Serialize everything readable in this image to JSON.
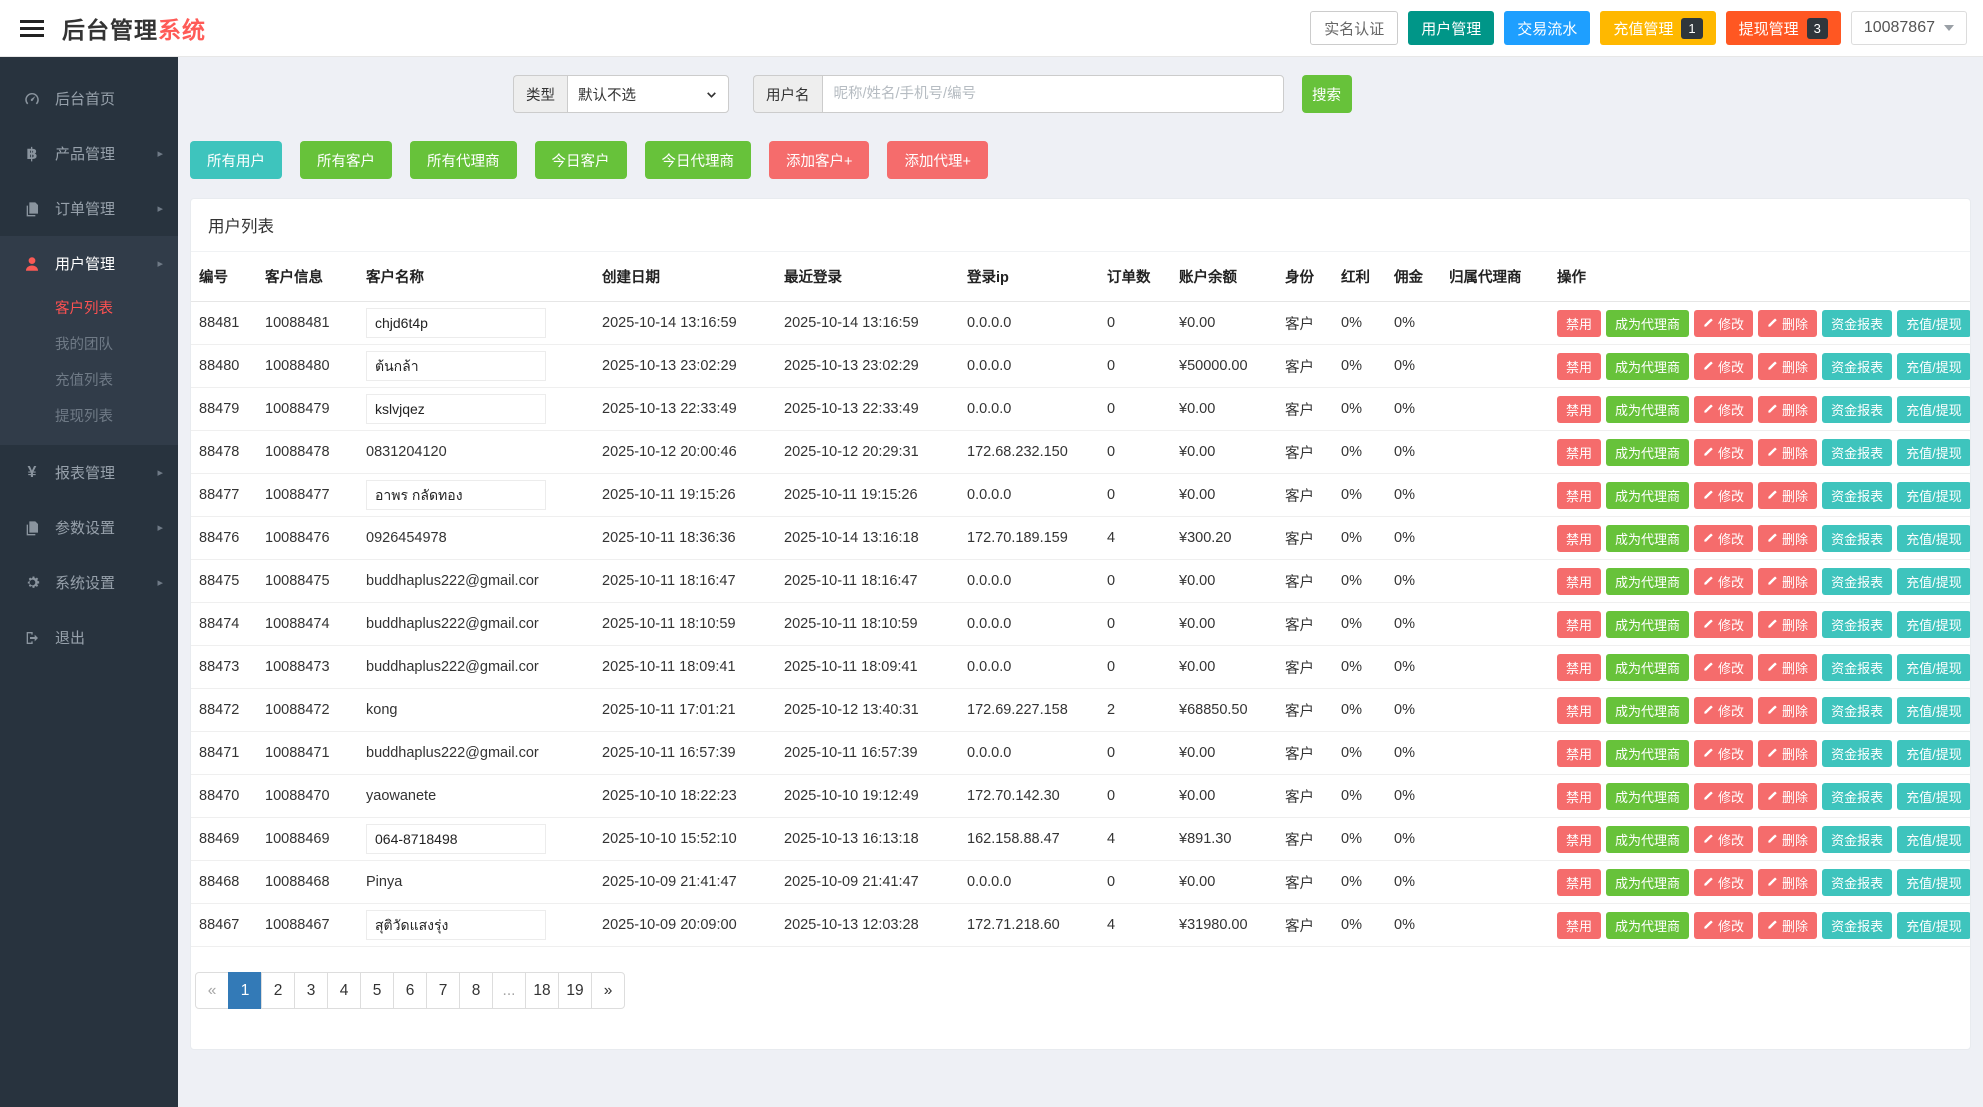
{
  "header": {
    "title_primary": "后台管理",
    "title_accent": "系统",
    "buttons": [
      {
        "key": "real-name-auth-button",
        "label": "实名认证",
        "style": "plain",
        "badge": ""
      },
      {
        "key": "user-manage-button",
        "label": "用户管理",
        "style": "teal",
        "badge": ""
      },
      {
        "key": "transaction-flow-button",
        "label": "交易流水",
        "style": "blue",
        "badge": ""
      },
      {
        "key": "recharge-manage-button",
        "label": "充值管理",
        "style": "amber",
        "badge": "1"
      },
      {
        "key": "withdraw-manage-button",
        "label": "提现管理",
        "style": "orange",
        "badge": "3"
      }
    ],
    "user_id": "10087867"
  },
  "sidebar": {
    "items": [
      {
        "key": "home",
        "label": "后台首页",
        "icon": "dashboard-icon",
        "arrow": false,
        "active": false
      },
      {
        "key": "product",
        "label": "产品管理",
        "icon": "baht-icon",
        "arrow": true,
        "active": false
      },
      {
        "key": "orders",
        "label": "订单管理",
        "icon": "files-icon",
        "arrow": true,
        "active": false
      },
      {
        "key": "users",
        "label": "用户管理",
        "icon": "user-icon",
        "arrow": true,
        "active": true,
        "children": [
          {
            "key": "customer-list",
            "label": "客户列表",
            "active": true
          },
          {
            "key": "my-team",
            "label": "我的团队",
            "active": false
          },
          {
            "key": "recharge-list",
            "label": "充值列表",
            "active": false
          },
          {
            "key": "withdraw-list",
            "label": "提现列表",
            "active": false
          }
        ]
      },
      {
        "key": "reports",
        "label": "报表管理",
        "icon": "yen-icon",
        "arrow": true,
        "active": false
      },
      {
        "key": "params",
        "label": "参数设置",
        "icon": "files-icon",
        "arrow": true,
        "active": false
      },
      {
        "key": "system",
        "label": "系统设置",
        "icon": "gear-icon",
        "arrow": true,
        "active": false
      },
      {
        "key": "logout",
        "label": "退出",
        "icon": "logout-icon",
        "arrow": false,
        "active": false
      }
    ]
  },
  "search": {
    "type_label": "类型",
    "type_value": "默认不选",
    "username_label": "用户名",
    "username_placeholder": "昵称/姓名/手机号/编号",
    "search_button": "搜索"
  },
  "filters": [
    {
      "key": "all-users-button",
      "label": "所有用户",
      "color": "cyan"
    },
    {
      "key": "all-customers-button",
      "label": "所有客户",
      "color": "green"
    },
    {
      "key": "all-agents-button",
      "label": "所有代理商",
      "color": "green"
    },
    {
      "key": "today-customers-button",
      "label": "今日客户",
      "color": "green"
    },
    {
      "key": "today-agents-button",
      "label": "今日代理商",
      "color": "green"
    },
    {
      "key": "add-customer-button",
      "label": "添加客户+",
      "color": "red"
    },
    {
      "key": "add-agent-button",
      "label": "添加代理+",
      "color": "red"
    }
  ],
  "table": {
    "panel_title": "用户列表",
    "columns": [
      "编号",
      "客户信息",
      "客户名称",
      "创建日期",
      "最近登录",
      "登录ip",
      "订单数",
      "账户余额",
      "身份",
      "红利",
      "佣金",
      "归属代理商",
      "操作"
    ],
    "action_buttons": [
      {
        "key": "disable-button",
        "label": "禁用",
        "color": "red",
        "icon": ""
      },
      {
        "key": "become-agent-button",
        "label": "成为代理商",
        "color": "green",
        "icon": ""
      },
      {
        "key": "edit-button",
        "label": "修改",
        "color": "red",
        "icon": "pencil-icon"
      },
      {
        "key": "delete-button",
        "label": "删除",
        "color": "red",
        "icon": "pencil-icon"
      },
      {
        "key": "funds-report-button",
        "label": "资金报表",
        "color": "teal",
        "icon": ""
      },
      {
        "key": "recharge-withdraw-button",
        "label": "充值/提现",
        "color": "teal",
        "icon": ""
      }
    ],
    "rows": [
      {
        "id": "88481",
        "info": "10088481",
        "name": "chjd6t4p",
        "boxed": true,
        "created": "2025-10-14 13:16:59",
        "last_login": "2025-10-14 13:16:59",
        "ip": "0.0.0.0",
        "orders": "0",
        "balance": "¥0.00",
        "identity": "客户",
        "bonus": "0%",
        "commission": "0%",
        "agent": ""
      },
      {
        "id": "88480",
        "info": "10088480",
        "name": "ต้นกล้า",
        "boxed": true,
        "created": "2025-10-13 23:02:29",
        "last_login": "2025-10-13 23:02:29",
        "ip": "0.0.0.0",
        "orders": "0",
        "balance": "¥50000.00",
        "identity": "客户",
        "bonus": "0%",
        "commission": "0%",
        "agent": ""
      },
      {
        "id": "88479",
        "info": "10088479",
        "name": "kslvjqez",
        "boxed": true,
        "created": "2025-10-13 22:33:49",
        "last_login": "2025-10-13 22:33:49",
        "ip": "0.0.0.0",
        "orders": "0",
        "balance": "¥0.00",
        "identity": "客户",
        "bonus": "0%",
        "commission": "0%",
        "agent": ""
      },
      {
        "id": "88478",
        "info": "10088478",
        "name": "0831204120",
        "boxed": false,
        "created": "2025-10-12 20:00:46",
        "last_login": "2025-10-12 20:29:31",
        "ip": "172.68.232.150",
        "orders": "0",
        "balance": "¥0.00",
        "identity": "客户",
        "bonus": "0%",
        "commission": "0%",
        "agent": ""
      },
      {
        "id": "88477",
        "info": "10088477",
        "name": "อาพร กลัดทอง",
        "boxed": true,
        "created": "2025-10-11 19:15:26",
        "last_login": "2025-10-11 19:15:26",
        "ip": "0.0.0.0",
        "orders": "0",
        "balance": "¥0.00",
        "identity": "客户",
        "bonus": "0%",
        "commission": "0%",
        "agent": ""
      },
      {
        "id": "88476",
        "info": "10088476",
        "name": "0926454978",
        "boxed": false,
        "created": "2025-10-11 18:36:36",
        "last_login": "2025-10-14 13:16:18",
        "ip": "172.70.189.159",
        "orders": "4",
        "balance": "¥300.20",
        "identity": "客户",
        "bonus": "0%",
        "commission": "0%",
        "agent": ""
      },
      {
        "id": "88475",
        "info": "10088475",
        "name": "buddhaplus222@gmail.cor",
        "boxed": false,
        "created": "2025-10-11 18:16:47",
        "last_login": "2025-10-11 18:16:47",
        "ip": "0.0.0.0",
        "orders": "0",
        "balance": "¥0.00",
        "identity": "客户",
        "bonus": "0%",
        "commission": "0%",
        "agent": ""
      },
      {
        "id": "88474",
        "info": "10088474",
        "name": "buddhaplus222@gmail.cor",
        "boxed": false,
        "created": "2025-10-11 18:10:59",
        "last_login": "2025-10-11 18:10:59",
        "ip": "0.0.0.0",
        "orders": "0",
        "balance": "¥0.00",
        "identity": "客户",
        "bonus": "0%",
        "commission": "0%",
        "agent": ""
      },
      {
        "id": "88473",
        "info": "10088473",
        "name": "buddhaplus222@gmail.cor",
        "boxed": false,
        "created": "2025-10-11 18:09:41",
        "last_login": "2025-10-11 18:09:41",
        "ip": "0.0.0.0",
        "orders": "0",
        "balance": "¥0.00",
        "identity": "客户",
        "bonus": "0%",
        "commission": "0%",
        "agent": ""
      },
      {
        "id": "88472",
        "info": "10088472",
        "name": "kong",
        "boxed": false,
        "created": "2025-10-11 17:01:21",
        "last_login": "2025-10-12 13:40:31",
        "ip": "172.69.227.158",
        "orders": "2",
        "balance": "¥68850.50",
        "identity": "客户",
        "bonus": "0%",
        "commission": "0%",
        "agent": ""
      },
      {
        "id": "88471",
        "info": "10088471",
        "name": "buddhaplus222@gmail.cor",
        "boxed": false,
        "created": "2025-10-11 16:57:39",
        "last_login": "2025-10-11 16:57:39",
        "ip": "0.0.0.0",
        "orders": "0",
        "balance": "¥0.00",
        "identity": "客户",
        "bonus": "0%",
        "commission": "0%",
        "agent": ""
      },
      {
        "id": "88470",
        "info": "10088470",
        "name": "yaowanete",
        "boxed": false,
        "created": "2025-10-10 18:22:23",
        "last_login": "2025-10-10 19:12:49",
        "ip": "172.70.142.30",
        "orders": "0",
        "balance": "¥0.00",
        "identity": "客户",
        "bonus": "0%",
        "commission": "0%",
        "agent": ""
      },
      {
        "id": "88469",
        "info": "10088469",
        "name": "064-8718498",
        "boxed": true,
        "created": "2025-10-10 15:52:10",
        "last_login": "2025-10-13 16:13:18",
        "ip": "162.158.88.47",
        "orders": "4",
        "balance": "¥891.30",
        "identity": "客户",
        "bonus": "0%",
        "commission": "0%",
        "agent": ""
      },
      {
        "id": "88468",
        "info": "10088468",
        "name": "Pinya",
        "boxed": false,
        "created": "2025-10-09 21:41:47",
        "last_login": "2025-10-09 21:41:47",
        "ip": "0.0.0.0",
        "orders": "0",
        "balance": "¥0.00",
        "identity": "客户",
        "bonus": "0%",
        "commission": "0%",
        "agent": ""
      },
      {
        "id": "88467",
        "info": "10088467",
        "name": "สุติวัดแสงรุ่ง",
        "boxed": true,
        "created": "2025-10-09 20:09:00",
        "last_login": "2025-10-13 12:03:28",
        "ip": "172.71.218.60",
        "orders": "4",
        "balance": "¥31980.00",
        "identity": "客户",
        "bonus": "0%",
        "commission": "0%",
        "agent": ""
      }
    ]
  },
  "pagination": {
    "pages": [
      "«",
      "1",
      "2",
      "3",
      "4",
      "5",
      "6",
      "7",
      "8",
      "...",
      "18",
      "19",
      "»"
    ],
    "active": "1"
  },
  "colors": {
    "accent_title": "#FF5B57",
    "teal": "#009688",
    "blue": "#1E9FFF",
    "amber": "#FFB800",
    "orange_red": "#FF5722",
    "badge_bg": "#2F363C",
    "green": "#67C23A",
    "cyan": "#3EC4BD",
    "salmon": "#F56C6C",
    "balance_red": "#FF0000",
    "pagination_active": "#337AB7",
    "sidebar_bg": "#28333E",
    "sidebar_active_bg": "#313C49",
    "sidebar_active_red": "#FF5151",
    "page_bg": "#EEF0F5"
  }
}
